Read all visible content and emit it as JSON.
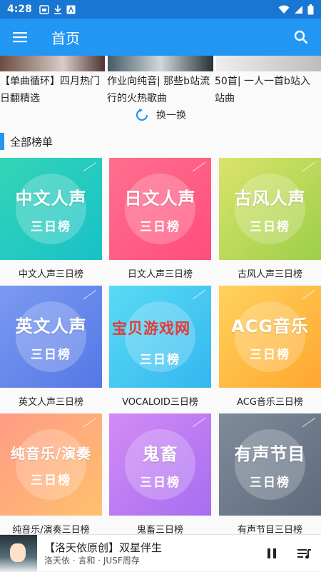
{
  "statusbar": {
    "time": "4:28"
  },
  "appbar": {
    "title": "首页"
  },
  "recommend": {
    "titles": [
      "【单曲循环】四月热门日翻精选",
      "作业向纯音| 那些b站流行的火热歌曲",
      "50首| 一人一首b站入站曲"
    ]
  },
  "refresh": {
    "label": "换一换"
  },
  "section": {
    "title": "全部榜单"
  },
  "charts": [
    {
      "cover_main": "中文人声",
      "cover_sub": "三日榜",
      "name": "中文人声三日榜"
    },
    {
      "cover_main": "日文人声",
      "cover_sub": "三日榜",
      "name": "日文人声三日榜"
    },
    {
      "cover_main": "古风人声",
      "cover_sub": "三日榜",
      "name": "古风人声三日榜"
    },
    {
      "cover_main": "英文人声",
      "cover_sub": "三日榜",
      "name": "英文人声三日榜"
    },
    {
      "cover_main": "宝贝游戏网",
      "cover_sub": "三日榜",
      "name": "VOCALOID三日榜"
    },
    {
      "cover_main": "ACG音乐",
      "cover_sub": "三日榜",
      "name": "ACG音乐三日榜"
    },
    {
      "cover_main": "纯音乐/演奏",
      "cover_sub": "三日榜",
      "name": "纯音乐/演奏三日榜"
    },
    {
      "cover_main": "鬼畜",
      "cover_sub": "三日榜",
      "name": "鬼畜三日榜"
    },
    {
      "cover_main": "有声节目",
      "cover_sub": "三日榜",
      "name": "有声节目三日榜"
    }
  ],
  "player": {
    "song": "【洛天依原创】双星伴生",
    "artist": "洛天依 · 言和 · JUSF周存"
  },
  "colors": {
    "primary": "#2196f3",
    "statusbar": "#1976d2"
  }
}
